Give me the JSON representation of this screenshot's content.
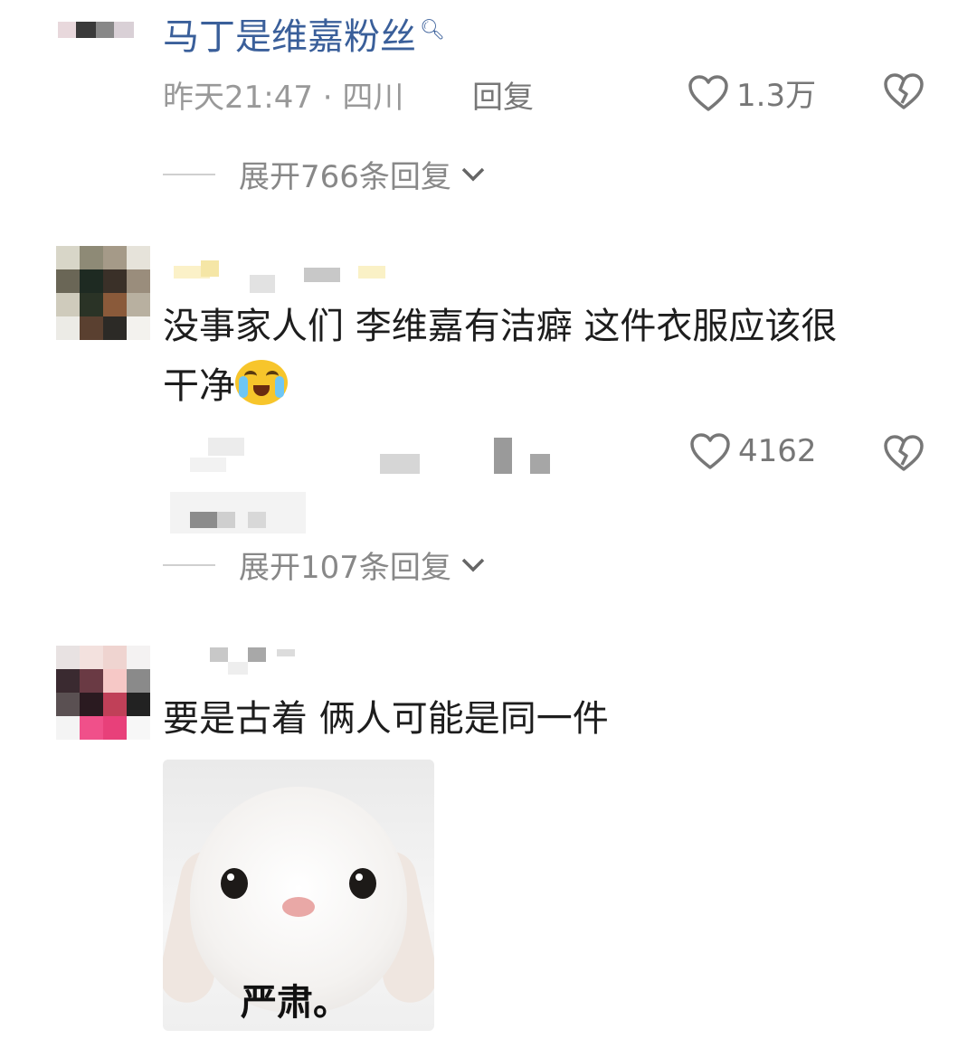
{
  "top_comment": {
    "title": "马丁是维嘉粉丝",
    "search_icon": "search-icon",
    "time_location": "昨天21:47 · 四川",
    "reply_label": "回复",
    "like_count": "1.3万",
    "expand_replies": "展开766条回复"
  },
  "comment2": {
    "text_line1": "没事家人们 李维嘉有洁癖 这件衣服应该很",
    "text_line2": "干净",
    "like_count": "4162",
    "expand_replies": "展开107条回复"
  },
  "comment3": {
    "text": "要是古着 俩人可能是同一件",
    "sticker_caption": "严肃。"
  },
  "colors": {
    "link": "#3a5f9a",
    "muted": "#999999"
  }
}
